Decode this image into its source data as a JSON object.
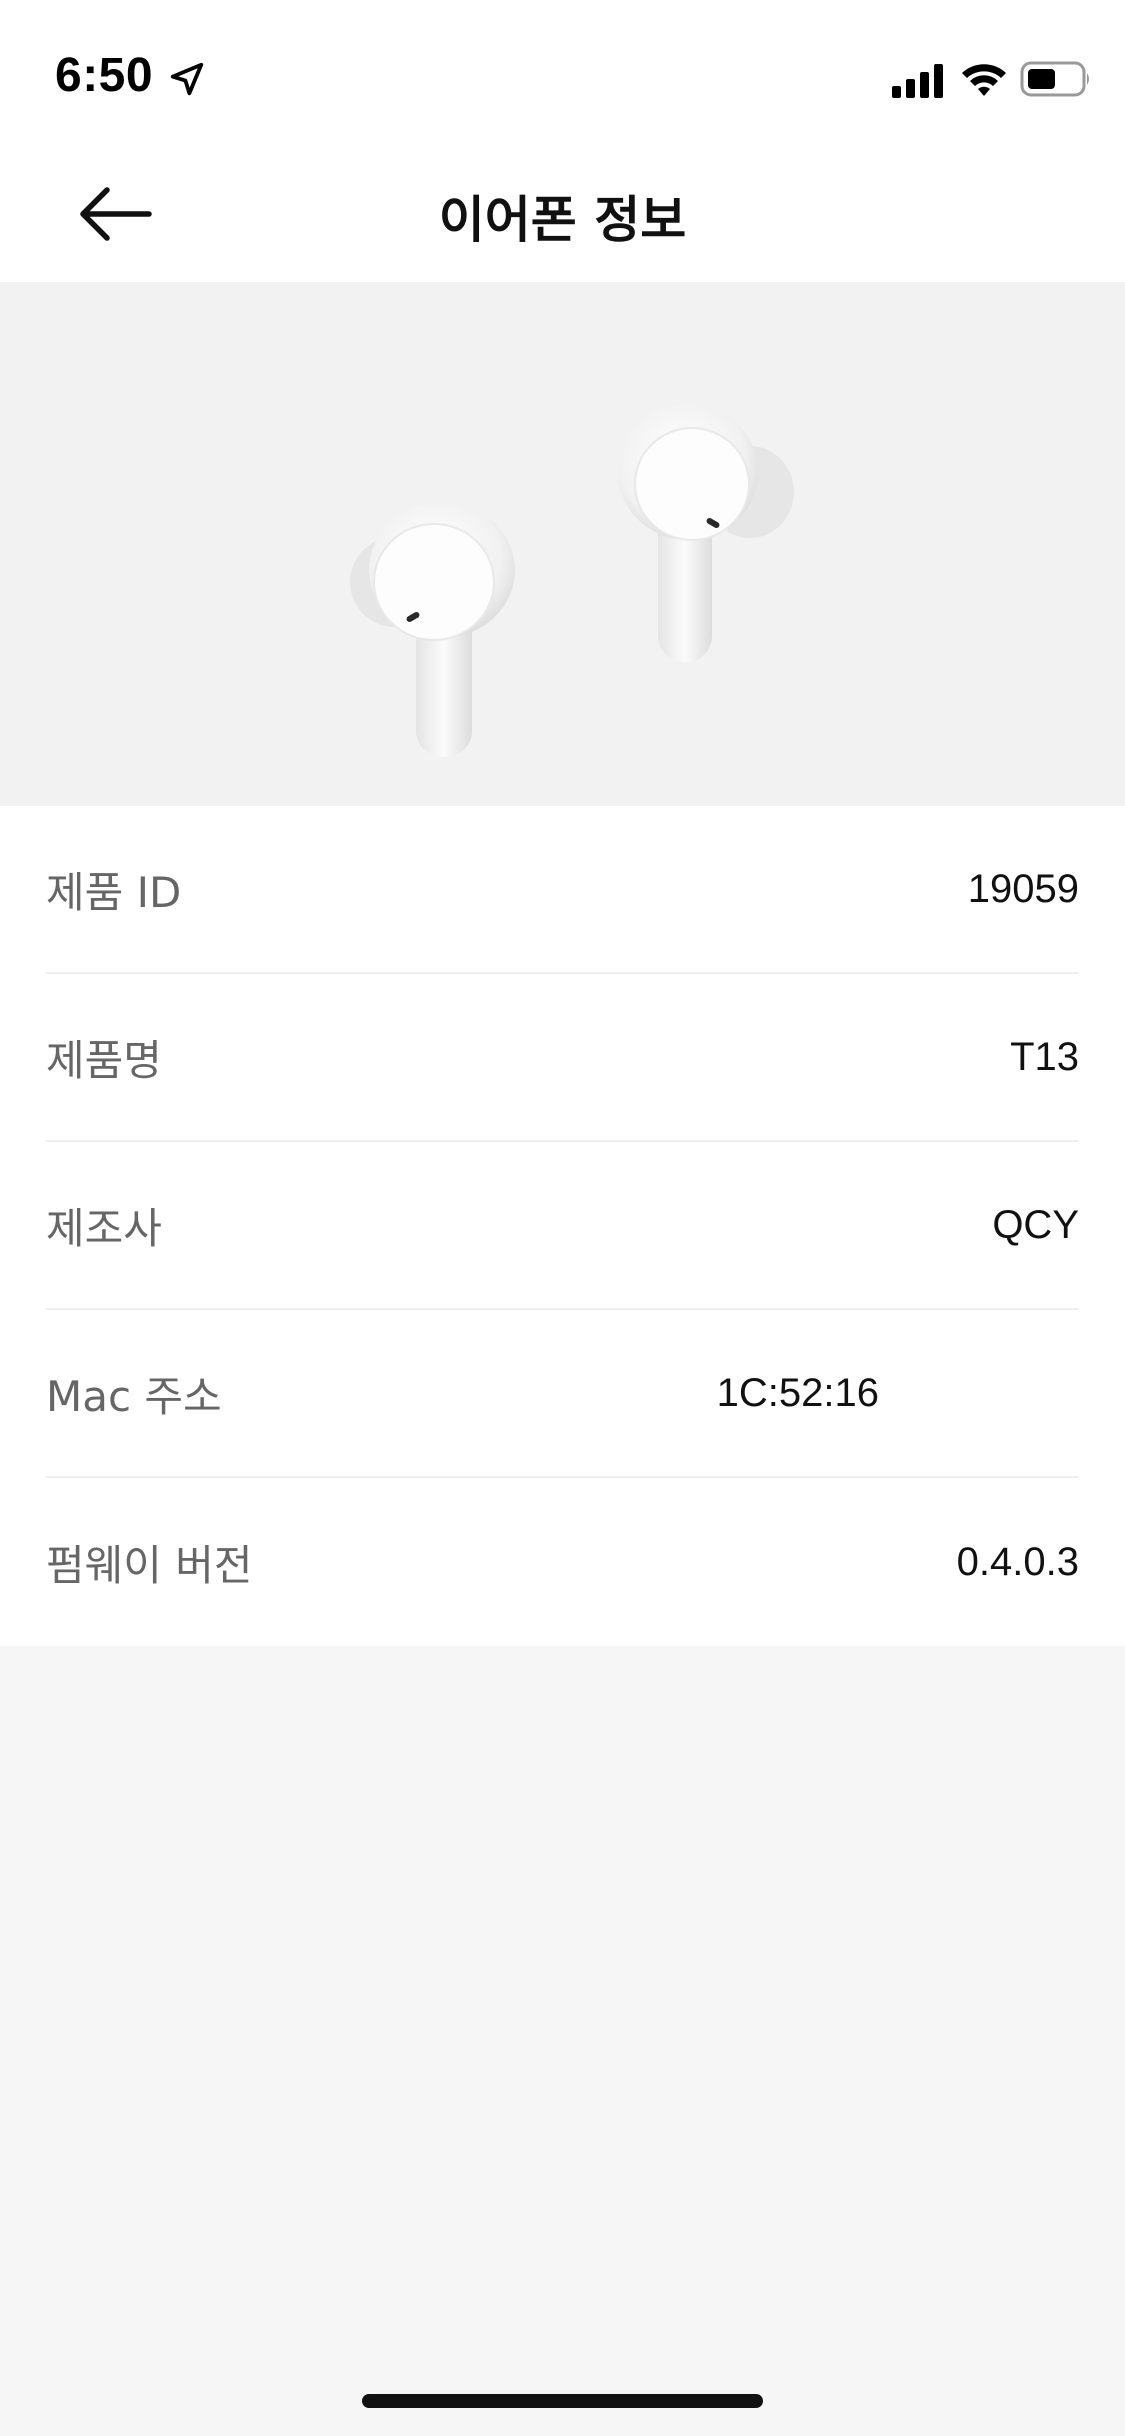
{
  "status_bar": {
    "time": "6:50",
    "icons": [
      "location-arrow-icon",
      "cellular-signal-icon",
      "wifi-icon",
      "battery-icon"
    ]
  },
  "nav": {
    "back_icon": "arrow-left-icon",
    "title": "이어폰 정보"
  },
  "hero": {
    "image": "white-earbuds-image"
  },
  "info": {
    "rows": [
      {
        "label": "제품 ID",
        "value": "19059"
      },
      {
        "label": "제품명",
        "value": "T13"
      },
      {
        "label": "제조사",
        "value": "QCY"
      },
      {
        "label": "Mac 주소",
        "value": "1C:52:16"
      },
      {
        "label": "펌웨이 버전",
        "value": "0.4.0.3"
      }
    ]
  },
  "colors": {
    "header_bg": "#ffffff",
    "page_bg": "#f6f6f6",
    "hero_bg": "#f2f2f2",
    "label_text": "#666666",
    "value_text": "#111111"
  }
}
